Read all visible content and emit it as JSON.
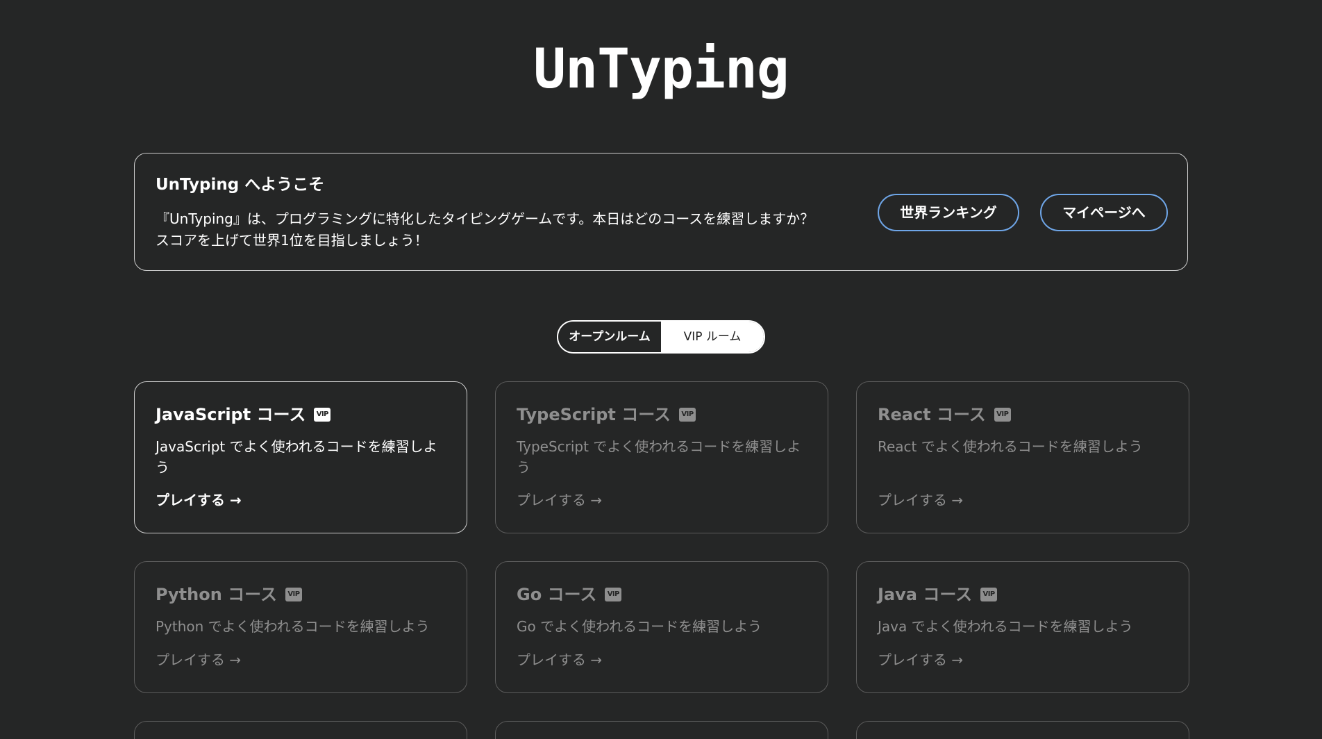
{
  "app": {
    "title": "UnTyping"
  },
  "welcome": {
    "title": "UnTyping へようこそ",
    "line1": "『UnTyping』は、プログラミングに特化したタイピングゲームです。本日はどのコースを練習しますか？",
    "line2": "スコアを上げて世界1位を目指しましょう！",
    "ranking_label": "世界ランキング",
    "mypage_label": "マイページへ",
    "accent_color": "#6fa6e8"
  },
  "tabs": {
    "open_label": "オープンルーム",
    "vip_label": "VIP ルーム",
    "selected": "open"
  },
  "courses": [
    {
      "title": "JavaScript コース",
      "badge": "VIP",
      "description": "JavaScript でよく使われるコードを練習しよう",
      "play_label": "プレイする →",
      "active": true
    },
    {
      "title": "TypeScript コース",
      "badge": "VIP",
      "description": "TypeScript でよく使われるコードを練習しよう",
      "play_label": "プレイする →",
      "active": false
    },
    {
      "title": "React コース",
      "badge": "VIP",
      "description": "React でよく使われるコードを練習しよう",
      "play_label": "プレイする →",
      "active": false
    },
    {
      "title": "Python コース",
      "badge": "VIP",
      "description": "Python でよく使われるコードを練習しよう",
      "play_label": "プレイする →",
      "active": false
    },
    {
      "title": "Go コース",
      "badge": "VIP",
      "description": "Go でよく使われるコードを練習しよう",
      "play_label": "プレイする →",
      "active": false
    },
    {
      "title": "Java コース",
      "badge": "VIP",
      "description": "Java でよく使われるコードを練習しよう",
      "play_label": "プレイする →",
      "active": false
    }
  ],
  "colors": {
    "background": "#252626",
    "muted_text": "#8f8f8f",
    "card_border": "#5c5c5c"
  }
}
